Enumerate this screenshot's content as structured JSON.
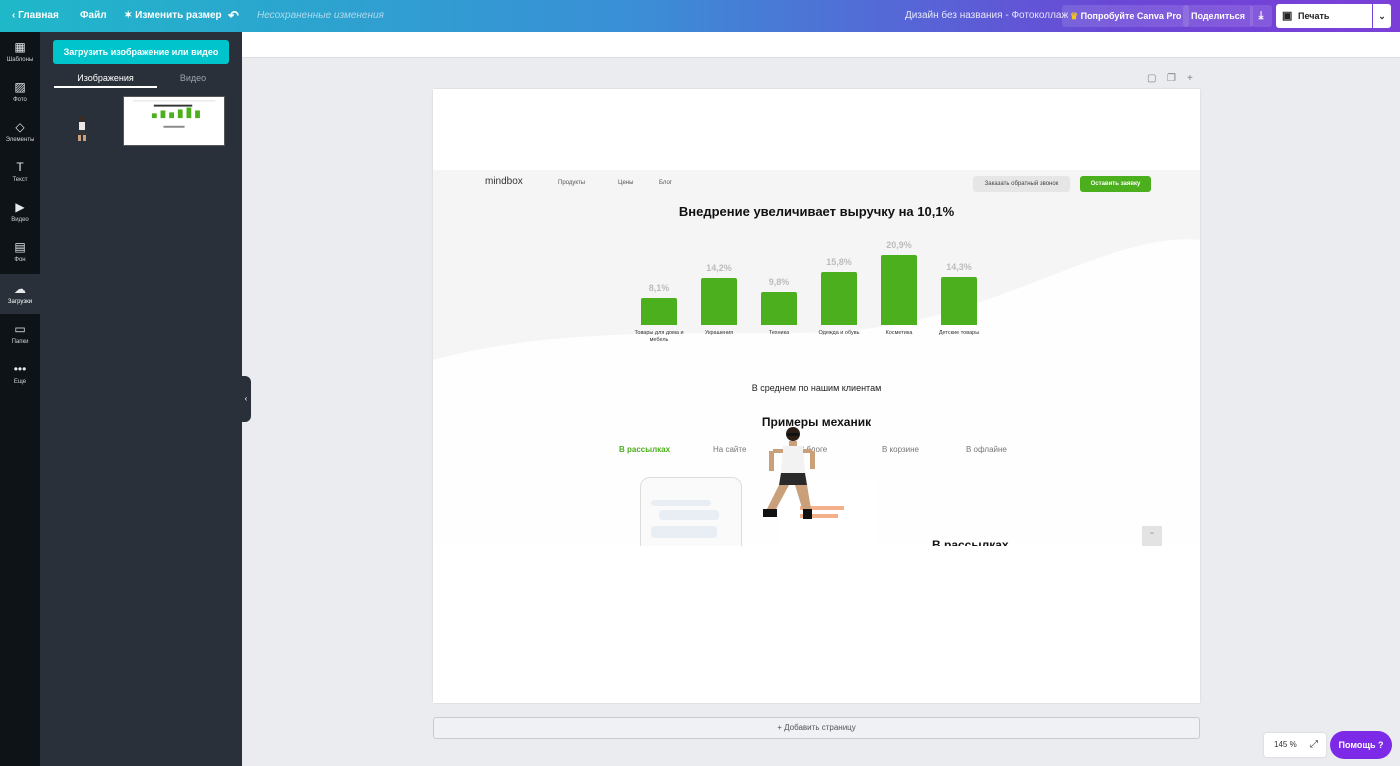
{
  "topbar": {
    "home": "Главная",
    "file": "Файл",
    "resize": "Изменить размер",
    "unsaved": "Несохраненные изменения",
    "doc_title": "Дизайн без названия - Фотоколлаж",
    "try_pro": "Попробуйте Canva Pro",
    "share": "Поделиться",
    "print": "Печать плакатов"
  },
  "rail": {
    "items": [
      {
        "label": "Шаблоны",
        "icon": "templates-icon"
      },
      {
        "label": "Фото",
        "icon": "photo-icon"
      },
      {
        "label": "Элементы",
        "icon": "elements-icon"
      },
      {
        "label": "Текст",
        "icon": "text-icon"
      },
      {
        "label": "Видео",
        "icon": "video-icon"
      },
      {
        "label": "Фон",
        "icon": "background-icon"
      },
      {
        "label": "Загрузки",
        "icon": "upload-icon"
      },
      {
        "label": "Папки",
        "icon": "folder-icon"
      },
      {
        "label": "Еще",
        "icon": "more-icon"
      }
    ],
    "active_index": 6
  },
  "panel": {
    "upload_button": "Загрузить изображение или видео",
    "tabs": [
      "Изображения",
      "Видео"
    ],
    "active_tab": 0
  },
  "editor": {
    "add_page": "+ Добавить страницу",
    "zoom": "145 %",
    "help": "Помощь ?"
  },
  "mindbox": {
    "logo": "mindbox",
    "nav": [
      "Продукты",
      "Цены",
      "Блог"
    ],
    "callback_button": "Заказать обратный звонок",
    "leave_request_button": "Оставить заявку",
    "headline": "Внедрение увеличивает выручку на 10,1%",
    "subtitle": "В среднем по нашим клиентам",
    "section_title": "Примеры механик",
    "tabs": [
      "В рассылках",
      "На сайте",
      "В блоге",
      "В корзине",
      "В офлайне"
    ],
    "active_tab": 0,
    "section_heading": "В рассылках"
  },
  "chart_data": {
    "type": "bar",
    "title": "Внедрение увеличивает выручку на 10,1%",
    "categories": [
      "Товары для дома и мебель",
      "Украшения",
      "Техника",
      "Одежда и обувь",
      "Косметика",
      "Детские товары"
    ],
    "values": [
      8.1,
      14.2,
      9.8,
      15.8,
      20.9,
      14.3
    ],
    "value_labels": [
      "8,1%",
      "14,2%",
      "9,8%",
      "15,8%",
      "20,9%",
      "14,3%"
    ],
    "unit": "%",
    "ylim": [
      0,
      21
    ],
    "grid": false,
    "legend": "none",
    "bar_color": "#4caf1d"
  },
  "colors": {
    "accent_teal": "#00c4cc",
    "accent_purple": "#7d2ae8",
    "panel_bg": "#293039",
    "rail_bg": "#0e1318",
    "green": "#4caf1d"
  }
}
